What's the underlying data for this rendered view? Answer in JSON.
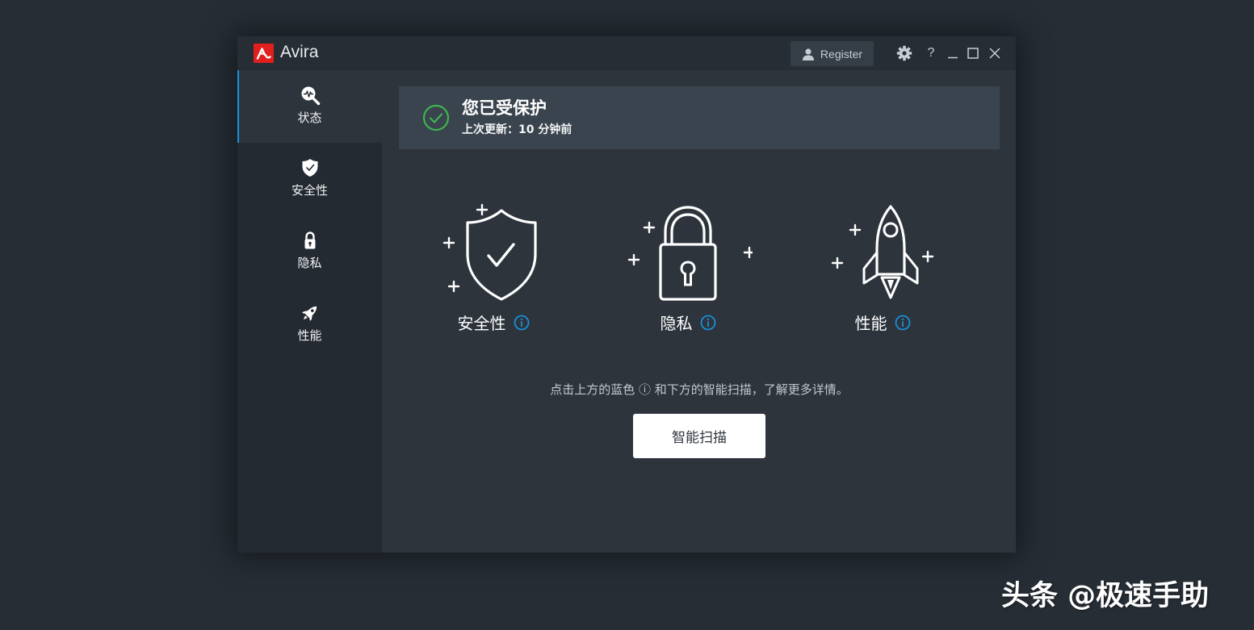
{
  "app": {
    "name": "Avira",
    "brand_color": "#e1201d"
  },
  "titlebar": {
    "register_label": "Register",
    "help_label": "?"
  },
  "sidebar": {
    "accent_color": "#1a8fd9",
    "items": [
      {
        "label": "状态",
        "icon": "status-scan-icon",
        "active": true
      },
      {
        "label": "安全性",
        "icon": "shield-icon",
        "active": false
      },
      {
        "label": "隐私",
        "icon": "lock-icon",
        "active": false
      },
      {
        "label": "性能",
        "icon": "rocket-icon",
        "active": false
      }
    ]
  },
  "status": {
    "title": "您已受保护",
    "subtitle": "上次更新：10 分钟前",
    "ok_color": "#3fb34f"
  },
  "features": [
    {
      "label": "安全性",
      "icon": "shield-check-icon"
    },
    {
      "label": "隐私",
      "icon": "padlock-icon"
    },
    {
      "label": "性能",
      "icon": "rocket-icon"
    }
  ],
  "hint": "点击上方的蓝色 ⓘ 和下方的智能扫描，了解更多详情。",
  "scan_button": {
    "label": "智能扫描"
  },
  "watermark": "头条 @极速手助"
}
